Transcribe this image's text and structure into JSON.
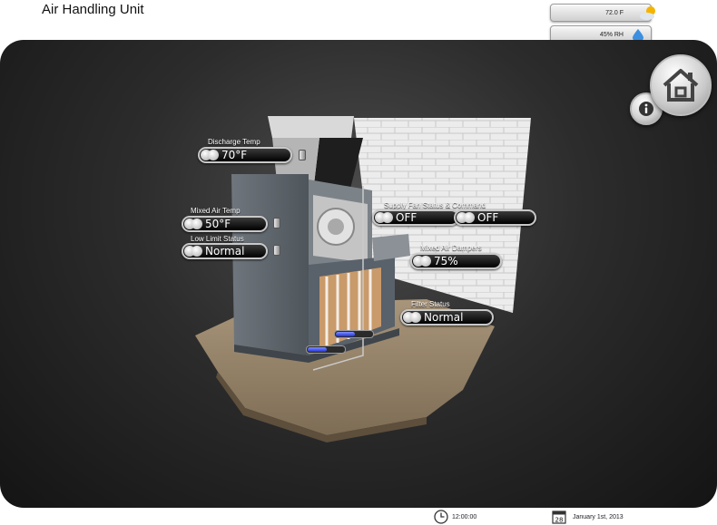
{
  "header": {
    "title": "Air Handling Unit",
    "outdoor_temp": "72.0 F",
    "outdoor_humidity": "45% RH"
  },
  "points": {
    "discharge_temp": {
      "label": "Discharge Temp",
      "value": "70°F"
    },
    "mixed_air_temp": {
      "label": "Mixed Air Temp",
      "value": "50°F"
    },
    "low_limit_status": {
      "label": "Low Limit Status",
      "value": "Normal"
    },
    "supply_fan": {
      "label": "Supply Fan Status & Command",
      "status": "OFF",
      "command": "OFF"
    },
    "mixed_air_dampers": {
      "label": "Mixed Air Dampers",
      "value": "75%"
    },
    "filter_status": {
      "label": "Filter Status",
      "value": "Normal"
    }
  },
  "valves": {
    "upper_fill": 0.5,
    "lower_fill": 0.5,
    "fill_color": "#2233dd"
  },
  "footer": {
    "time": "12:00:00",
    "date": "January 1st, 2013",
    "calendar_day": "28"
  },
  "icons": {
    "weather": "partly-cloudy-icon",
    "humidity": "water-drop-icon",
    "home": "home-icon",
    "info": "info-icon",
    "clock": "clock-icon",
    "calendar": "calendar-icon"
  }
}
